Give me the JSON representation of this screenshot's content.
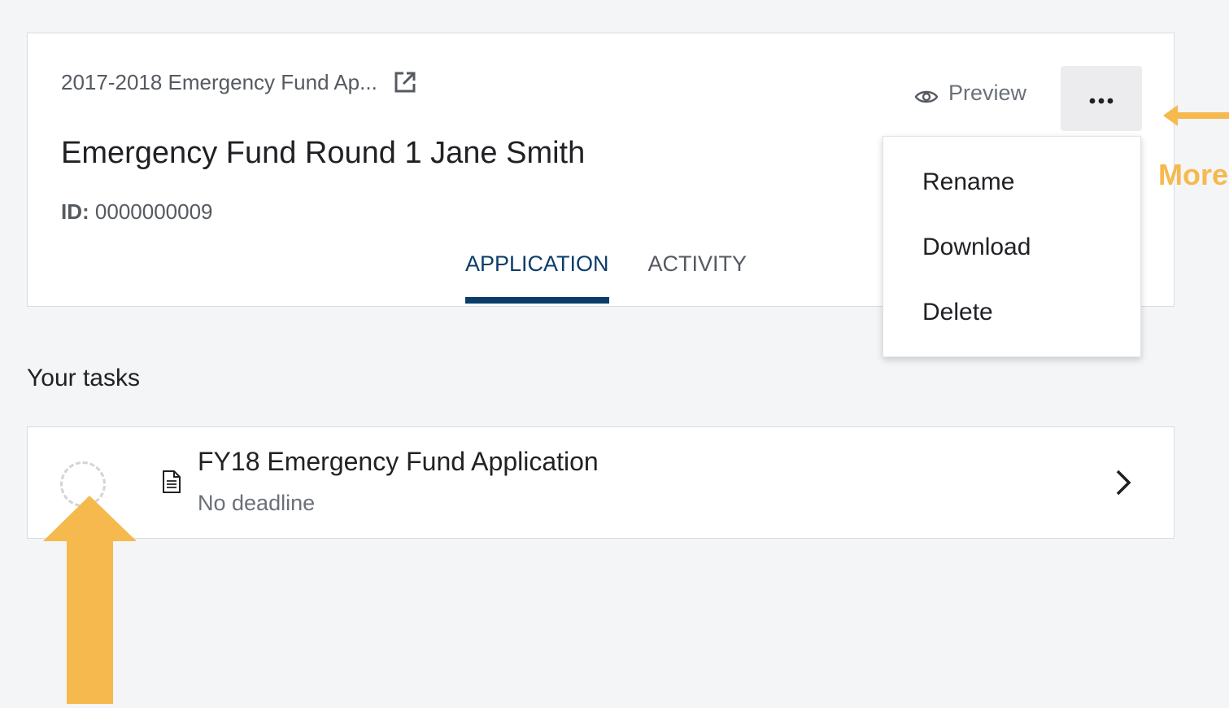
{
  "colors": {
    "accent": "#0b3d6b",
    "annotation": "#f5b94e",
    "background": "#f4f5f7"
  },
  "header": {
    "breadcrumb": "2017-2018 Emergency Fund Ap...",
    "breadcrumb_icon": "external-link-icon",
    "title": "Emergency Fund Round 1 Jane Smith",
    "id_label": "ID:",
    "id_value": " 0000000009",
    "preview_label": "Preview",
    "preview_icon": "eye-icon",
    "more_icon": "more-dots-icon"
  },
  "tabs": [
    {
      "label": "APPLICATION",
      "active": true
    },
    {
      "label": "ACTIVITY",
      "active": false
    }
  ],
  "more_menu": {
    "items": [
      {
        "label": "Rename"
      },
      {
        "label": "Download"
      },
      {
        "label": "Delete"
      }
    ]
  },
  "tasks": {
    "heading": "Your tasks",
    "items": [
      {
        "title": "FY18 Emergency Fund Application",
        "subtitle": "No deadline",
        "icon": "document-icon",
        "status": "not-started"
      }
    ]
  },
  "annotations": {
    "more_label": "More"
  }
}
